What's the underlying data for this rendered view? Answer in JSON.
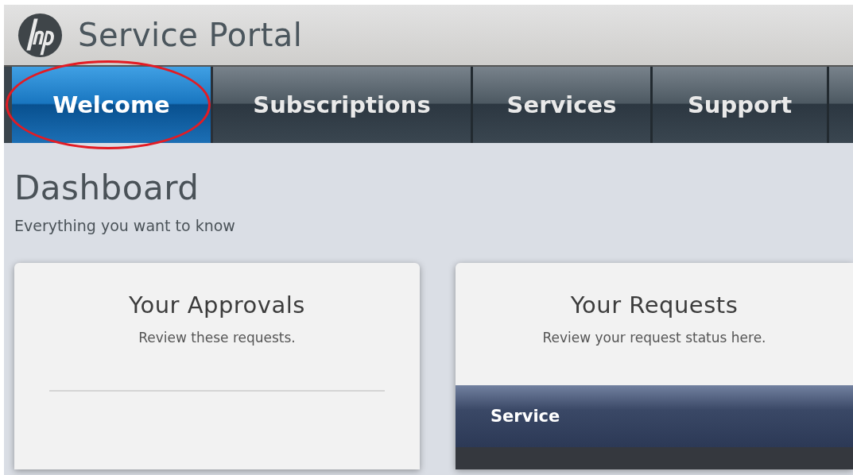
{
  "header": {
    "title": "Service Portal"
  },
  "tabs": [
    {
      "label": "Welcome",
      "selected": true,
      "circled": true
    },
    {
      "label": "Subscriptions",
      "selected": false,
      "circled": false
    },
    {
      "label": "Services",
      "selected": false,
      "circled": false
    },
    {
      "label": "Support",
      "selected": false,
      "circled": false
    }
  ],
  "page": {
    "title": "Dashboard",
    "subtitle": "Everything you want to know"
  },
  "cards": [
    {
      "kind": "approvals",
      "title": "Your Approvals",
      "subtitle": "Review these requests."
    },
    {
      "kind": "requests",
      "title": "Your Requests",
      "subtitle": "Review your request status here.",
      "columns": [
        "Service"
      ]
    }
  ]
}
